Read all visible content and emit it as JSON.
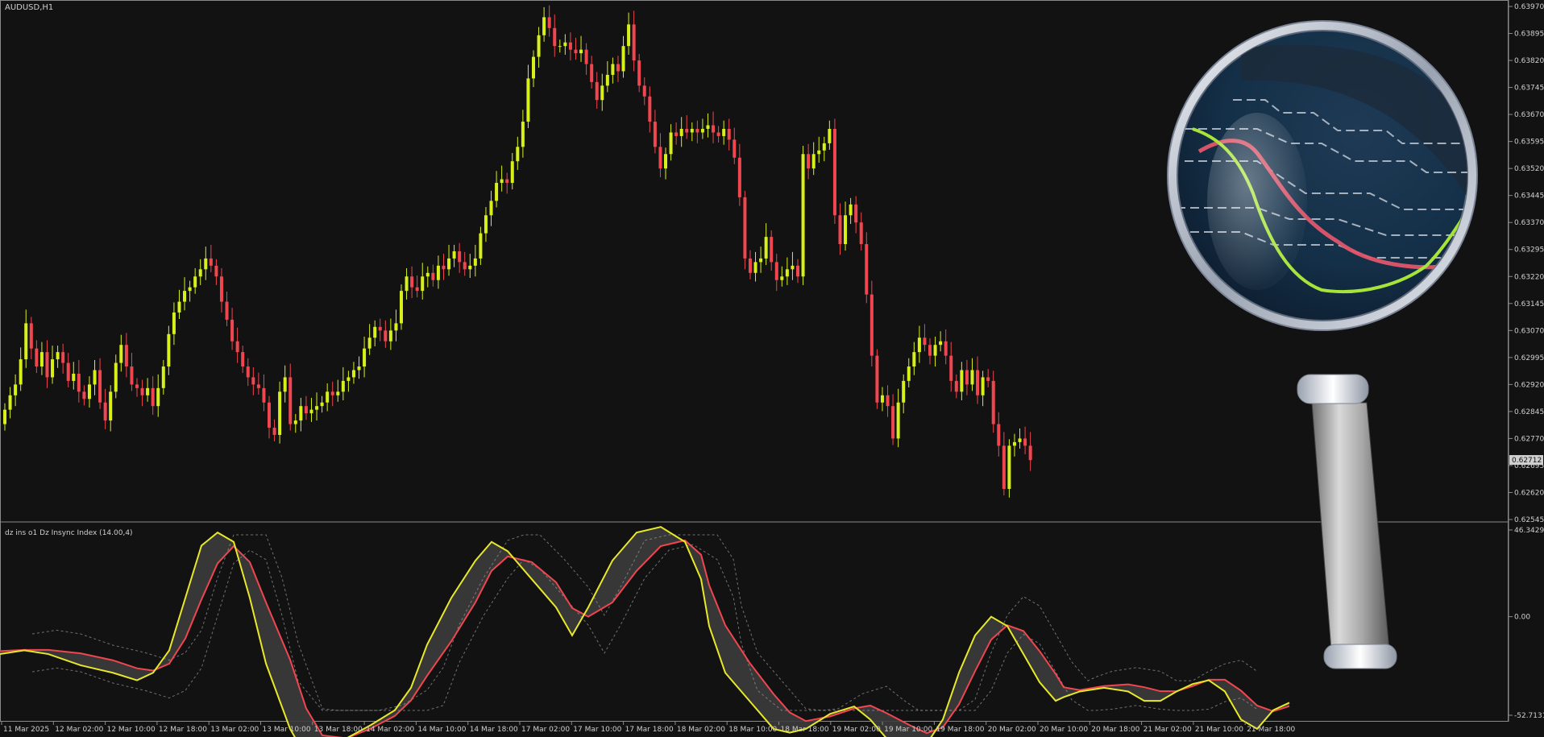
{
  "window": {
    "symbol_label": "AUDUSD,H1",
    "indicator_label": "dz ins o1 Dz Insync Index (14.00,4)",
    "current_price_label": "0.62712"
  },
  "price_axis": {
    "ticks": [
      "0.63970",
      "0.63895",
      "0.63820",
      "0.63745",
      "0.63670",
      "0.63595",
      "0.63520",
      "0.63445",
      "0.63370",
      "0.63295",
      "0.63220",
      "0.63145",
      "0.63070",
      "0.62995",
      "0.62920",
      "0.62845",
      "0.62770",
      "0.62695",
      "0.62620",
      "0.62545"
    ]
  },
  "indicator_axis": {
    "ticks": [
      "46.3429",
      "0.00",
      "-52.7131"
    ]
  },
  "time_axis": {
    "ticks": [
      "11 Mar 2025",
      "12 Mar 02:00",
      "12 Mar 10:00",
      "12 Mar 18:00",
      "13 Mar 02:00",
      "13 Mar 10:00",
      "13 Mar 18:00",
      "14 Mar 02:00",
      "14 Mar 10:00",
      "14 Mar 18:00",
      "17 Mar 02:00",
      "17 Mar 10:00",
      "17 Mar 18:00",
      "18 Mar 02:00",
      "18 Mar 10:00",
      "18 Mar 18:00",
      "19 Mar 02:00",
      "19 Mar 10:00",
      "19 Mar 18:00",
      "20 Mar 02:00",
      "20 Mar 10:00",
      "20 Mar 18:00",
      "21 Mar 02:00",
      "21 Mar 10:00",
      "21 Mar 18:00"
    ]
  },
  "colors": {
    "background": "#121212",
    "bull": "#d7f01a",
    "bear": "#f0464f",
    "index_line": "#e8e82a",
    "signal_line": "#f0464f",
    "band": "#3c3c3c",
    "axis_text": "#cfcfcf",
    "grid_border": "#8a8a8a"
  },
  "icons": [
    "magnifier-icon"
  ],
  "chart_data": [
    {
      "type": "candlestick",
      "title": "AUDUSD,H1",
      "ylim": [
        0.62545,
        0.6397
      ],
      "closes": [
        0.6285,
        0.6289,
        0.6292,
        0.6299,
        0.6309,
        0.6302,
        0.6297,
        0.6301,
        0.6294,
        0.6299,
        0.6301,
        0.6298,
        0.6293,
        0.6295,
        0.629,
        0.6288,
        0.6292,
        0.6296,
        0.6287,
        0.6282,
        0.629,
        0.6298,
        0.6303,
        0.6297,
        0.6292,
        0.6291,
        0.6289,
        0.6291,
        0.6286,
        0.6291,
        0.6297,
        0.6306,
        0.6312,
        0.6315,
        0.6318,
        0.6319,
        0.6322,
        0.6324,
        0.6327,
        0.6325,
        0.6322,
        0.6315,
        0.631,
        0.6304,
        0.6301,
        0.6297,
        0.6294,
        0.6292,
        0.6291,
        0.6287,
        0.628,
        0.6278,
        0.629,
        0.6294,
        0.6281,
        0.6282,
        0.6286,
        0.6284,
        0.6285,
        0.6286,
        0.6287,
        0.629,
        0.6289,
        0.629,
        0.6293,
        0.6294,
        0.6296,
        0.6297,
        0.6302,
        0.6305,
        0.6308,
        0.6307,
        0.6304,
        0.6307,
        0.6309,
        0.6318,
        0.6322,
        0.6319,
        0.6318,
        0.6322,
        0.6323,
        0.6321,
        0.6325,
        0.6324,
        0.6327,
        0.6329,
        0.6326,
        0.6324,
        0.6325,
        0.6327,
        0.6334,
        0.6339,
        0.6343,
        0.6348,
        0.6349,
        0.6348,
        0.6354,
        0.6358,
        0.6365,
        0.6377,
        0.6383,
        0.6389,
        0.6394,
        0.6391,
        0.6386,
        0.6386,
        0.6387,
        0.6385,
        0.6384,
        0.6385,
        0.6381,
        0.6376,
        0.6371,
        0.6375,
        0.6378,
        0.6381,
        0.6379,
        0.6386,
        0.6392,
        0.6382,
        0.6375,
        0.6372,
        0.6365,
        0.6358,
        0.6352,
        0.6356,
        0.6362,
        0.6361,
        0.6363,
        0.6362,
        0.6363,
        0.6362,
        0.6363,
        0.6364,
        0.6362,
        0.6361,
        0.6363,
        0.636,
        0.6355,
        0.6344,
        0.6327,
        0.6323,
        0.6326,
        0.6327,
        0.6333,
        0.6326,
        0.6321,
        0.6322,
        0.6324,
        0.6325,
        0.6322,
        0.6356,
        0.6352,
        0.6356,
        0.6357,
        0.6359,
        0.6363,
        0.6339,
        0.6331,
        0.6339,
        0.6342,
        0.6337,
        0.6331,
        0.6317,
        0.63,
        0.6287,
        0.6289,
        0.6286,
        0.6277,
        0.6287,
        0.6293,
        0.6297,
        0.6301,
        0.6305,
        0.6303,
        0.63,
        0.6303,
        0.6304,
        0.63,
        0.6293,
        0.629,
        0.6296,
        0.6292,
        0.6296,
        0.6289,
        0.6294,
        0.6293,
        0.6281,
        0.6275,
        0.6263,
        0.6275,
        0.6276,
        0.6277,
        0.6275,
        0.6271
      ]
    },
    {
      "type": "line",
      "title": "dz ins o1 Dz Insync Index (14.00,4)",
      "ylim": [
        -52.7131,
        46.3429
      ],
      "series": []
    }
  ]
}
